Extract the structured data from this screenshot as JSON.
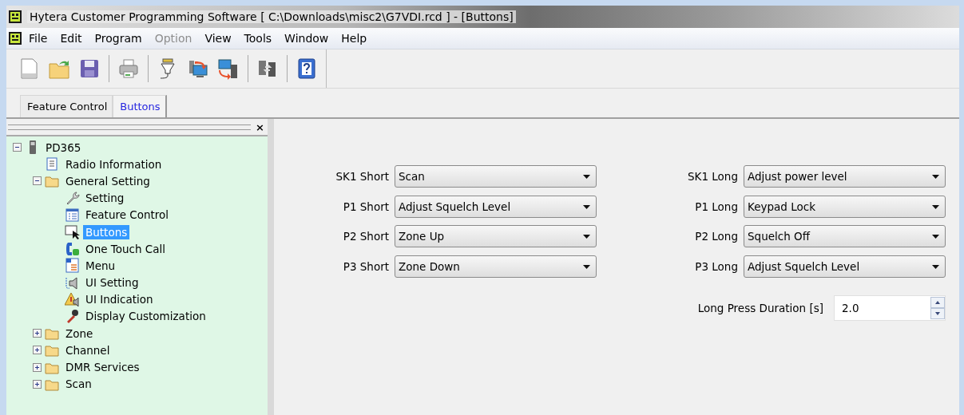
{
  "window": {
    "title": "Hytera Customer Programming Software [ C:\\Downloads\\misc2\\G7VDI.rcd ] - [Buttons]"
  },
  "menu": [
    {
      "label": "File",
      "disabled": false
    },
    {
      "label": "Edit",
      "disabled": false
    },
    {
      "label": "Program",
      "disabled": false
    },
    {
      "label": "Option",
      "disabled": true
    },
    {
      "label": "View",
      "disabled": false
    },
    {
      "label": "Tools",
      "disabled": false
    },
    {
      "label": "Window",
      "disabled": false
    },
    {
      "label": "Help",
      "disabled": false
    }
  ],
  "tabs": [
    {
      "label": "Feature Control",
      "selected": false
    },
    {
      "label": "Buttons",
      "selected": true
    }
  ],
  "tree_panel": {
    "close": "×",
    "tree": [
      {
        "label": "PD365",
        "kind": "radio",
        "expanded": true,
        "selected": false,
        "children": [
          {
            "label": "Radio Information",
            "kind": "info",
            "selected": false
          },
          {
            "label": "General Setting",
            "kind": "folder",
            "expanded": true,
            "selected": false,
            "children": [
              {
                "label": "Setting",
                "kind": "wrench",
                "selected": false
              },
              {
                "label": "Feature Control",
                "kind": "list",
                "selected": false
              },
              {
                "label": "Buttons",
                "kind": "pointer",
                "selected": true
              },
              {
                "label": "One Touch Call",
                "kind": "phone",
                "selected": false
              },
              {
                "label": "Menu",
                "kind": "menu",
                "selected": false
              },
              {
                "label": "UI Setting",
                "kind": "speaker",
                "selected": false
              },
              {
                "label": "UI Indication",
                "kind": "warning",
                "selected": false
              },
              {
                "label": "Display Customization",
                "kind": "mic",
                "selected": false
              }
            ]
          },
          {
            "label": "Zone",
            "kind": "folder",
            "expanded": false,
            "selected": false
          },
          {
            "label": "Channel",
            "kind": "folder",
            "expanded": false,
            "selected": false
          },
          {
            "label": "DMR Services",
            "kind": "folder",
            "expanded": false,
            "selected": false
          },
          {
            "label": "Scan",
            "kind": "folder",
            "expanded": false,
            "selected": false
          }
        ]
      }
    ]
  },
  "form": {
    "short": [
      {
        "label": "SK1 Short",
        "value": "Scan"
      },
      {
        "label": "P1 Short",
        "value": "Adjust Squelch Level"
      },
      {
        "label": "P2 Short",
        "value": "Zone Up"
      },
      {
        "label": "P3 Short",
        "value": "Zone Down"
      }
    ],
    "long": [
      {
        "label": "SK1 Long",
        "value": "Adjust power level"
      },
      {
        "label": "P1 Long",
        "value": "Keypad Lock"
      },
      {
        "label": "P2 Long",
        "value": "Squelch Off"
      },
      {
        "label": "P3 Long",
        "value": "Adjust Squelch Level"
      }
    ],
    "duration": {
      "label": "Long Press Duration [s]",
      "value": "2.0"
    }
  }
}
